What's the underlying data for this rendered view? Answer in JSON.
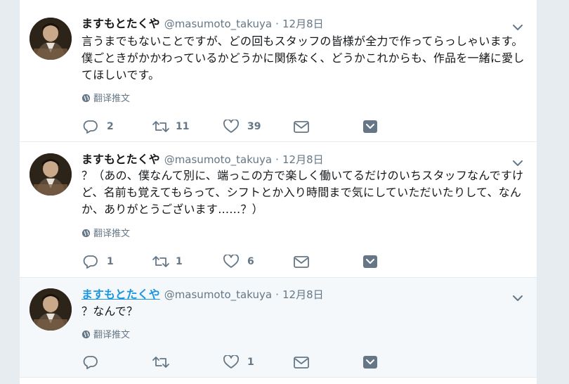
{
  "tweets": [
    {
      "name": "ますもとたくや",
      "handle": "@masumoto_takuya",
      "separator": "·",
      "time": "12月8日",
      "text": "言うまでもないことですが、どの回もスタッフの皆様が全力で作ってらっしゃいます。僕ごときがかかわっているかどうかに関係なく、どうかこれからも、作品を一緒に愛してほしいです。",
      "translate_label": "翻译推文",
      "reply_count": "2",
      "retweet_count": "11",
      "like_count": "39"
    },
    {
      "name": "ますもとたくや",
      "handle": "@masumoto_takuya",
      "separator": "·",
      "time": "12月8日",
      "text": "？（あの、僕なんて別に、端っこの方で楽しく働いてるだけのいちスタッフなんですけど、名前も覚えてもらって、シフトとか入り時間まで気にしていただいたりして、なんか、ありがとうございます……？）",
      "translate_label": "翻译推文",
      "reply_count": "1",
      "retweet_count": "1",
      "like_count": "6"
    },
    {
      "name": "ますもとたくや",
      "handle": "@masumoto_takuya",
      "separator": "·",
      "time": "12月8日",
      "text": "？なんで？",
      "translate_label": "翻译推文",
      "reply_count": "",
      "retweet_count": "",
      "like_count": "1"
    }
  ],
  "colors": {
    "text": "#14171a",
    "secondary": "#657786",
    "link": "#1b95e0",
    "background": "#e6ecf0",
    "hover": "#f5f8fa"
  },
  "icons": [
    "chevron-down-icon",
    "globe-icon",
    "reply-icon",
    "retweet-icon",
    "like-icon",
    "dm-icon",
    "add-to-moment-icon"
  ]
}
